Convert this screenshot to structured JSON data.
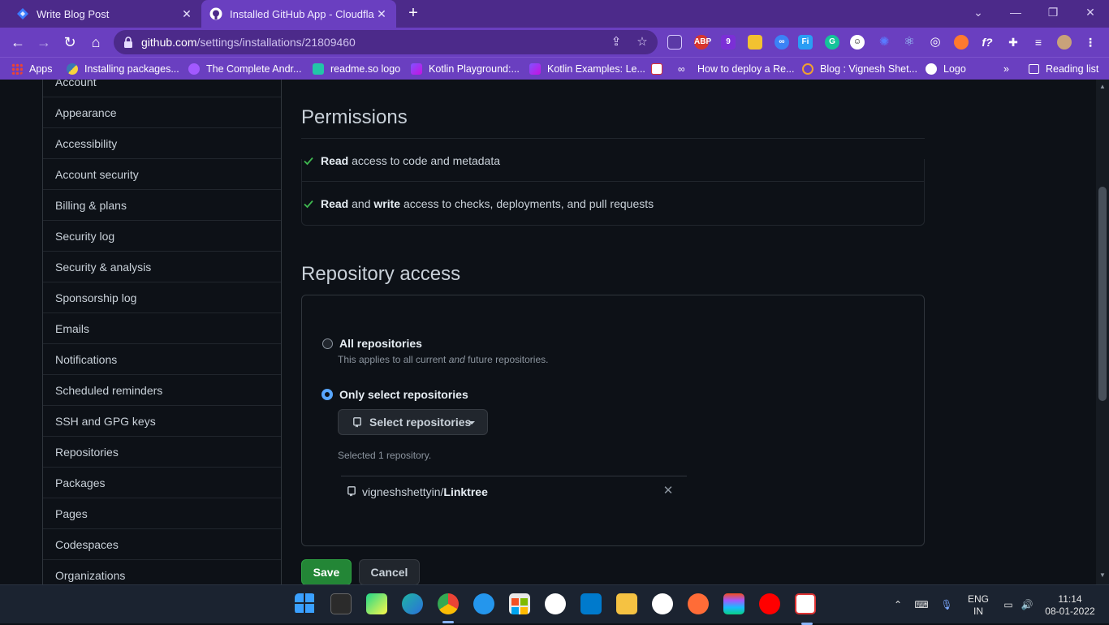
{
  "browser": {
    "tabs": [
      {
        "title": "Write Blog Post"
      },
      {
        "title": "Installed GitHub App - Cloudflare"
      }
    ],
    "url_host": "github.com",
    "url_path": "/settings/installations/21809460",
    "extensions": [
      "ABP",
      "9"
    ],
    "bookmarks": [
      "Apps",
      "Installing packages...",
      "The Complete Andr...",
      "readme.so logo",
      "Kotlin Playground:...",
      "Kotlin Examples: Le...",
      "How to deploy a Re...",
      "Blog : Vignesh Shet...",
      "Logo",
      "»",
      "Reading list"
    ]
  },
  "sidebar": {
    "items": [
      "Account",
      "Appearance",
      "Accessibility",
      "Account security",
      "Billing & plans",
      "Security log",
      "Security & analysis",
      "Sponsorship log",
      "Emails",
      "Notifications",
      "Scheduled reminders",
      "SSH and GPG keys",
      "Repositories",
      "Packages",
      "Pages",
      "Codespaces",
      "Organizations"
    ]
  },
  "permissions": {
    "heading": "Permissions",
    "rows": [
      {
        "bold1": "Read",
        "rest1": " access to code and metadata"
      },
      {
        "bold1": "Read",
        "mid": " and ",
        "bold2": "write",
        "rest": " access to checks, deployments, and pull requests"
      }
    ]
  },
  "repo_access": {
    "heading": "Repository access",
    "all_label": "All repositories",
    "all_note_a": "This applies to all current ",
    "all_note_em": "and",
    "all_note_b": " future repositories.",
    "only_label": "Only select repositories",
    "select_button": "Select repositories",
    "selected_note": "Selected 1 repository.",
    "repo_owner": "vigneshshettyin/",
    "repo_name": "Linktree"
  },
  "actions": {
    "save": "Save",
    "cancel": "Cancel"
  },
  "taskbar": {
    "lang_top": "ENG",
    "lang_bottom": "IN",
    "time": "11:14",
    "date": "08-01-2022"
  },
  "colors": {
    "browser_frame": "#4c2a8a",
    "browser_toolbar": "#6a3fc0",
    "page_bg": "#0d1117",
    "save_green": "#238636",
    "radio_blue": "#58a6ff"
  }
}
